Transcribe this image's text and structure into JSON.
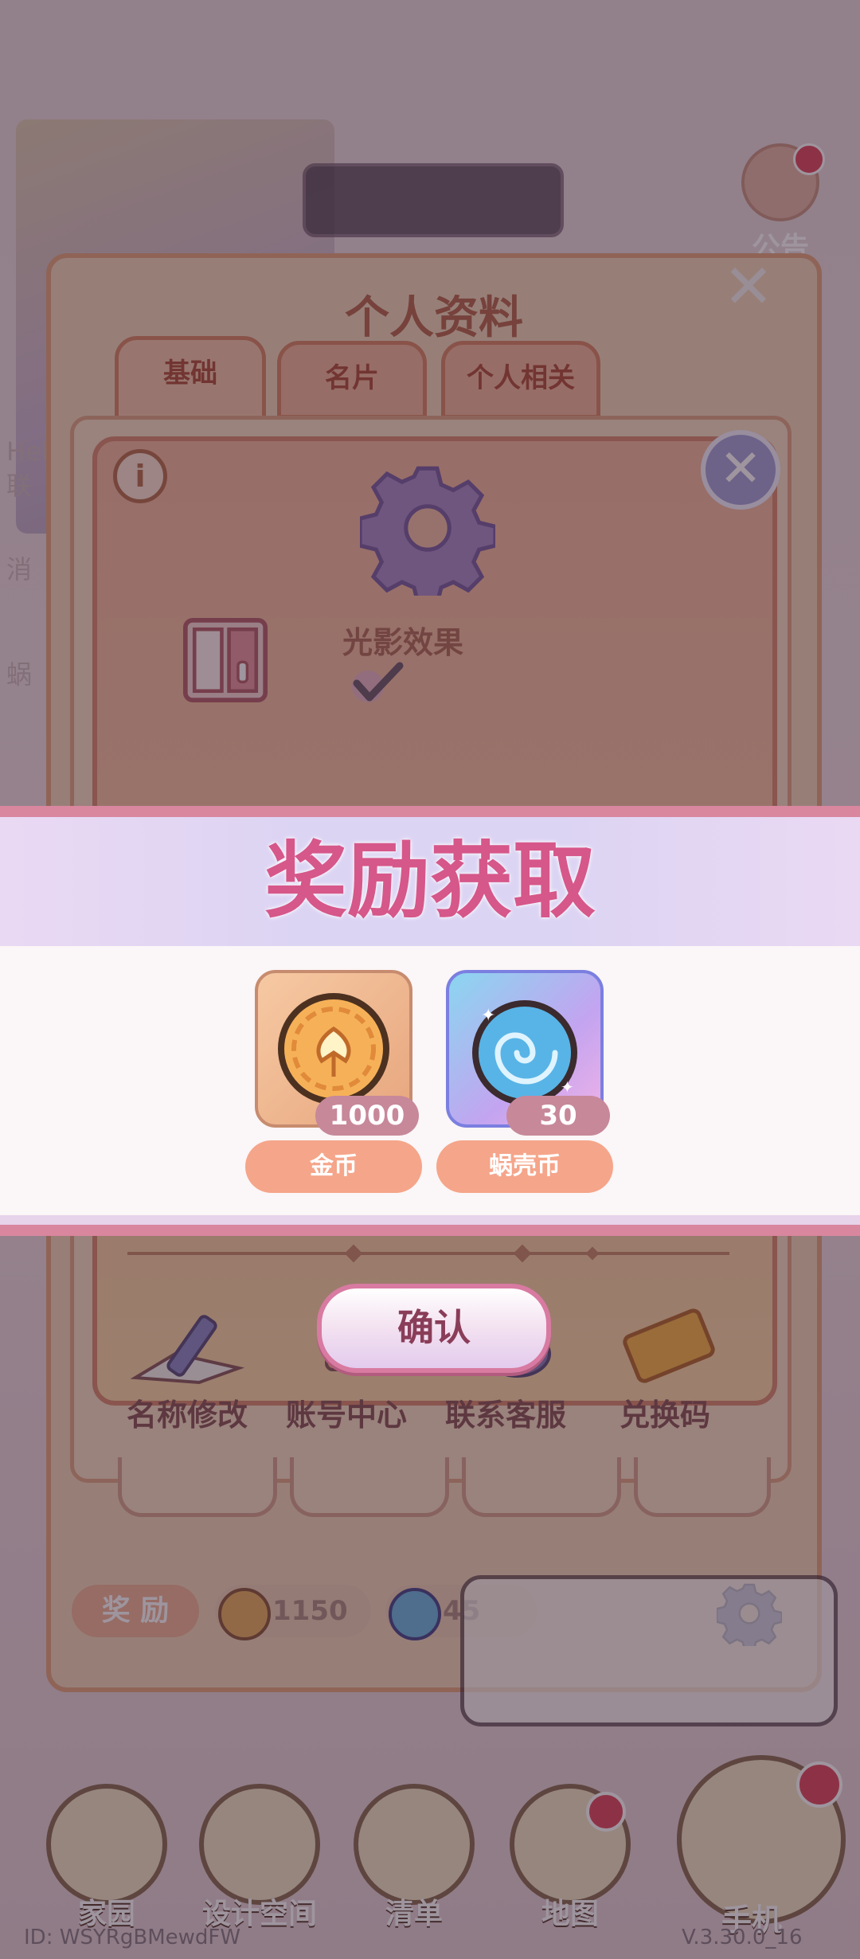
{
  "panel": {
    "title": "个人资料",
    "tabs": [
      {
        "label": "基础",
        "active": true
      },
      {
        "label": "名片",
        "active": false
      },
      {
        "label": "个人相关",
        "active": false
      }
    ]
  },
  "background": {
    "notice_label": "公告",
    "side_labels": [
      "Hell",
      "联",
      "消",
      "蜗"
    ]
  },
  "settings": {
    "info_symbol": "i",
    "light_effect_label": "光影效果",
    "light_effect_checked": true
  },
  "actions": [
    {
      "label": "名称修改",
      "icon": "pencil-paper-icon"
    },
    {
      "label": "账号中心",
      "icon": "key-icon"
    },
    {
      "label": "联系客服",
      "icon": "chat-icon"
    },
    {
      "label": "兑换码",
      "icon": "ticket-icon"
    }
  ],
  "reward_bar": {
    "label": "奖 励",
    "coins": "1150",
    "shells": "45"
  },
  "reward_modal": {
    "title": "奖励获取",
    "items": [
      {
        "name": "金币",
        "quantity": "1000",
        "icon": "gold-coin-icon"
      },
      {
        "name": "蜗壳币",
        "quantity": "30",
        "icon": "snail-shell-coin-icon"
      }
    ],
    "confirm_label": "确认"
  },
  "nav": [
    {
      "label": "家园",
      "icon": "house-icon"
    },
    {
      "label": "设计空间",
      "icon": "ruler-icon"
    },
    {
      "label": "清单",
      "icon": "checklist-icon"
    },
    {
      "label": "地图",
      "icon": "map-pin-icon"
    },
    {
      "label": "手机",
      "icon": "phone-icon"
    }
  ],
  "footer": {
    "id_text": "ID: WSYRgBMewdFW",
    "version_text": "V.3.30.0_16"
  },
  "colors": {
    "accent_pink": "#d6578a",
    "item_label_bg": "#f5a58a",
    "quantity_bg": "#c7889a",
    "notification_dot": "#e14c5f"
  }
}
